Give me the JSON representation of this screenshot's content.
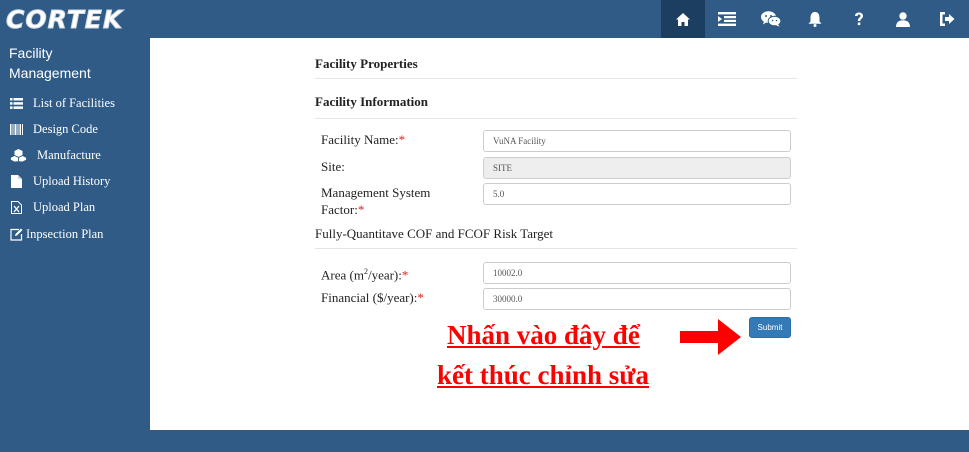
{
  "brand": {
    "logo_text": "CORTEK"
  },
  "topnav": {
    "icons": [
      "home-icon",
      "indent-list-icon",
      "wechat-icon",
      "bell-icon",
      "question-icon",
      "user-icon",
      "sign-out-icon"
    ],
    "active": "home-icon"
  },
  "sidebar": {
    "title_line1": "Facility",
    "title_line2": "Management",
    "items": [
      {
        "label": "List of Facilities",
        "icon": "list-icon"
      },
      {
        "label": "Design Code",
        "icon": "barcode-icon"
      },
      {
        "label": "Manufacture",
        "icon": "cubes-icon"
      },
      {
        "label": "Upload History",
        "icon": "file-icon"
      },
      {
        "label": "Upload Plan",
        "icon": "excel-file-icon"
      },
      {
        "label": "Inpsection Plan",
        "icon": "edit-icon"
      }
    ]
  },
  "main": {
    "section_properties": "Facility Properties",
    "section_information": "Facility Information",
    "facility_name_label": "Facility Name:",
    "facility_name_value": "VuNA Facility",
    "site_label": "Site:",
    "site_value": "SITE",
    "msf_label_line1": "Management System",
    "msf_label_line2": "Factor:",
    "msf_value": "5.0",
    "risk_title": "Fully-Quantitave COF and FCOF Risk Target",
    "area_label_prefix": "Area (m",
    "area_label_sup": "2",
    "area_label_suffix": "/year):",
    "area_value": "10002.0",
    "financial_label": "Financial ($/year):",
    "financial_value": "30000.0",
    "required_mark": "*",
    "submit_label": "Submit"
  },
  "annotation": {
    "line1": "Nhấn vào đây để",
    "line2": "kết thúc chỉnh sửa",
    "color": "#ff0000"
  },
  "colors": {
    "nav": "#2f5b86",
    "nav_active": "#1c3f61",
    "button": "#337ab7",
    "required": "#e02020"
  }
}
